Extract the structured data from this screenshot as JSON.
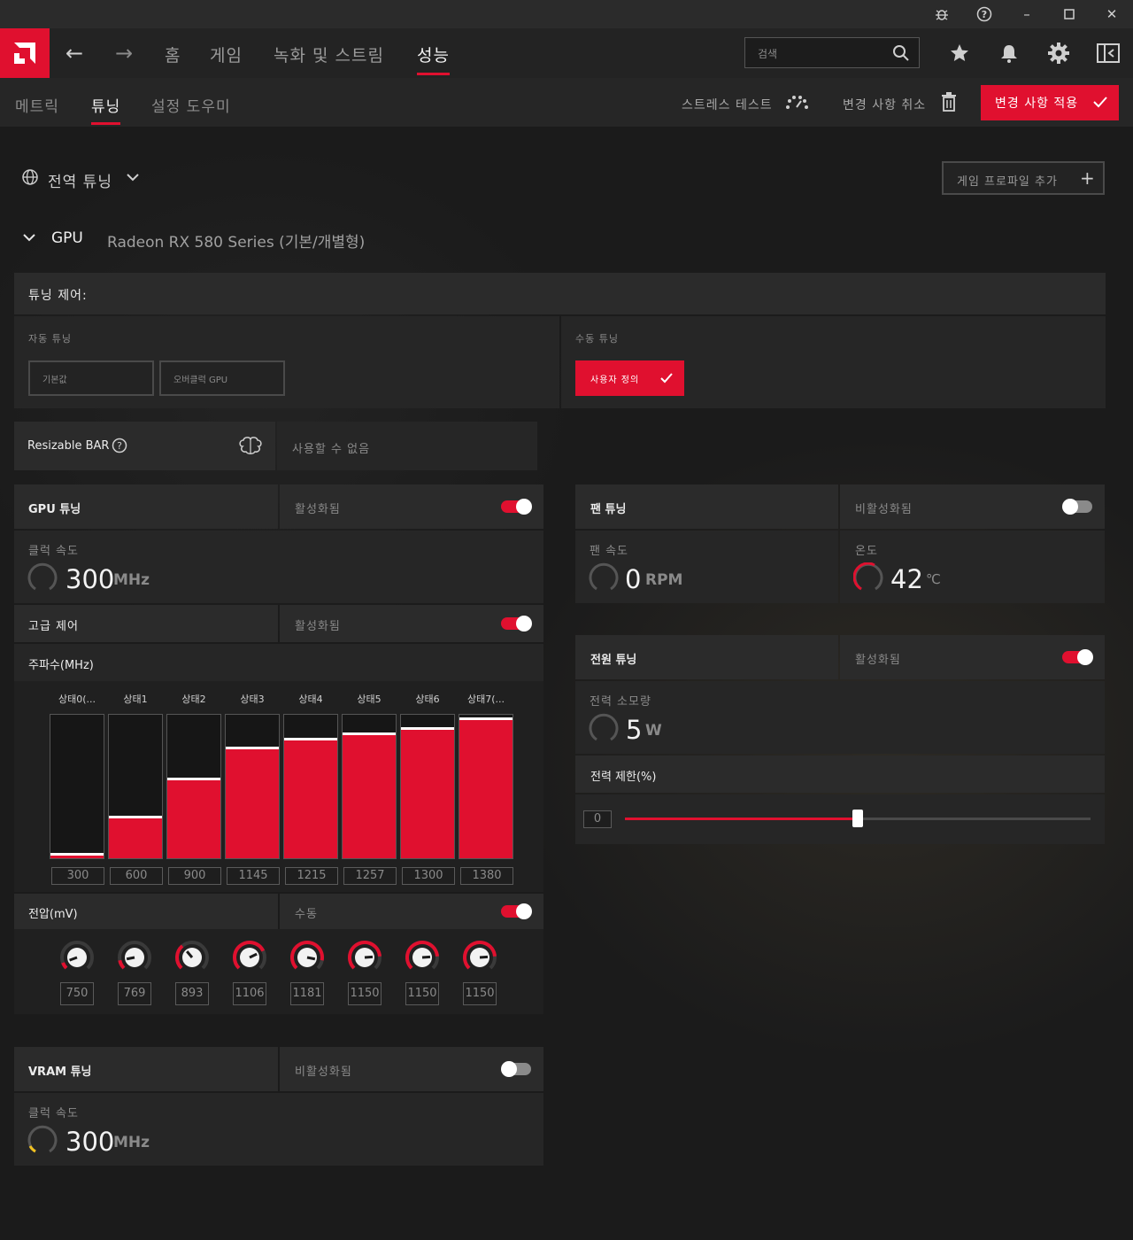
{
  "window": {
    "minimize": "–",
    "maximize": "☐",
    "close": "✕"
  },
  "topnav": {
    "tabs": [
      "홈",
      "게임",
      "녹화 및 스트림",
      "성능"
    ],
    "active_tab": "성능",
    "search_placeholder": "검색"
  },
  "subnav": {
    "tabs": [
      "메트릭",
      "튜닝",
      "설정 도우미"
    ],
    "active_tab": "튜닝",
    "stress_test": "스트레스 테스트",
    "discard": "변경 사항 취소",
    "apply": "변경 사항 적용"
  },
  "profile": {
    "scope": "전역 튜닝",
    "add_profile": "게임 프로파일 추가"
  },
  "gpu": {
    "label": "GPU",
    "name": "Radeon RX 580 Series (기본/개별형)"
  },
  "tuning_control": {
    "title": "튜닝 제어:",
    "auto_label": "자동 튜닝",
    "auto_options": [
      "기본값",
      "오버클럭 GPU"
    ],
    "manual_label": "수동 튜닝",
    "manual_option": "사용자 정의"
  },
  "resizable_bar": {
    "label": "Resizable BAR",
    "status": "사용할 수 없음"
  },
  "gpu_tuning": {
    "title": "GPU 튜닝",
    "status": "활성화됨",
    "enabled": true,
    "clock_label": "클럭 속도",
    "clock_value": "300",
    "clock_unit": "MHz"
  },
  "advanced": {
    "title": "고급 제어",
    "status": "활성화됨",
    "enabled": true
  },
  "frequency": {
    "title": "주파수(MHz)",
    "states": [
      "상태0(...",
      "상태1",
      "상태2",
      "상태3",
      "상태4",
      "상태5",
      "상태6",
      "상태7(..."
    ],
    "values": [
      "300",
      "600",
      "900",
      "1145",
      "1215",
      "1257",
      "1300",
      "1380"
    ],
    "min": 0,
    "max": 1400
  },
  "voltage": {
    "title": "전압(mV)",
    "mode": "수동",
    "enabled": true,
    "values": [
      "750",
      "769",
      "893",
      "1106",
      "1181",
      "1150",
      "1150",
      "1150"
    ],
    "min": 700,
    "max": 1250
  },
  "vram": {
    "title": "VRAM 튜닝",
    "status": "비활성화됨",
    "enabled": false,
    "clock_label": "클럭 속도",
    "clock_value": "300",
    "clock_unit": "MHz"
  },
  "fan": {
    "title": "팬 튜닝",
    "status": "비활성화됨",
    "enabled": false,
    "speed_label": "팬 속도",
    "speed_value": "0",
    "speed_unit": "RPM",
    "temp_label": "온도",
    "temp_value": "42",
    "temp_unit": "℃"
  },
  "power": {
    "title": "전원 튜닝",
    "status": "활성화됨",
    "enabled": true,
    "consumption_label": "전력 소모량",
    "consumption_value": "5",
    "consumption_unit": "W",
    "limit_label": "전력 제한(%)",
    "limit_value": "0",
    "limit_level": 0.5
  },
  "colors": {
    "accent": "#e0102f",
    "panel": "#262626",
    "bg": "#1b1b1b"
  }
}
